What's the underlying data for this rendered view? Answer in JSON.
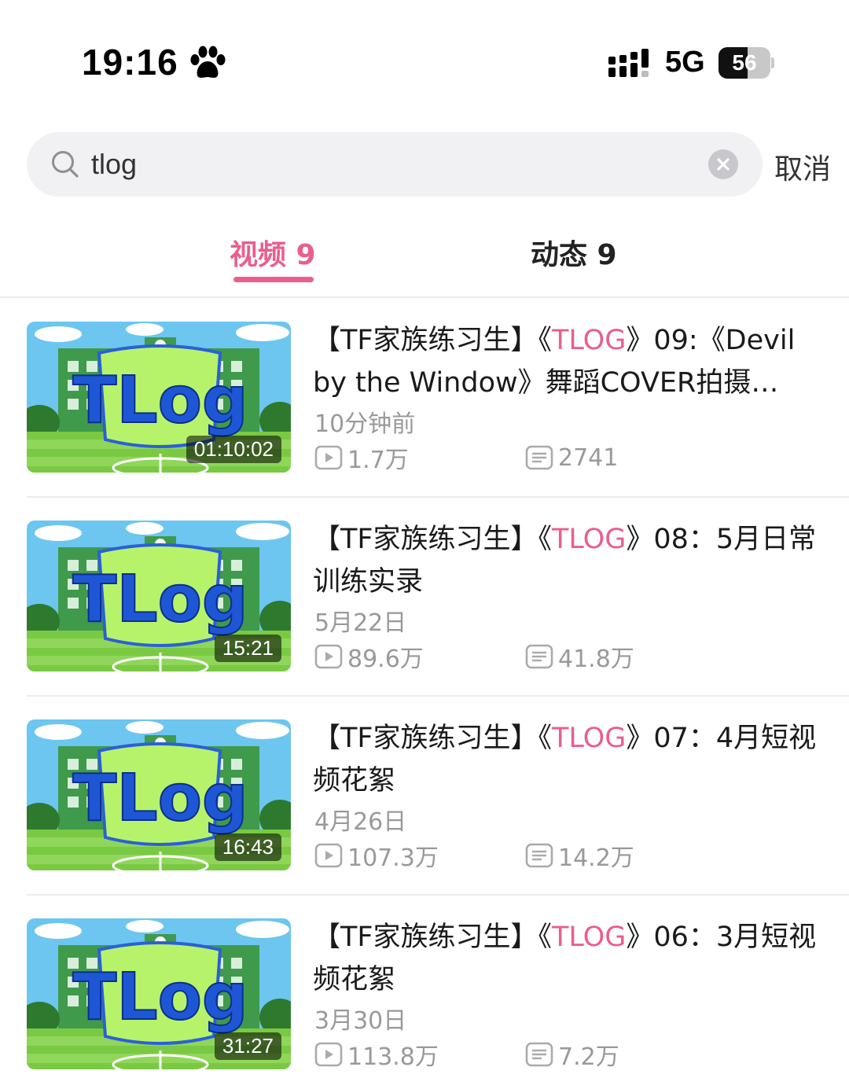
{
  "status_bar": {
    "time": "19:16",
    "time_icon": "paw-icon",
    "network": "5G",
    "battery_level": "56",
    "battery_fraction": 0.56
  },
  "search": {
    "query": "tlog",
    "cancel_label": "取消"
  },
  "tabs": [
    {
      "label": "视频 9",
      "active": true
    },
    {
      "label": "动态 9",
      "active": false
    }
  ],
  "colors": {
    "accent": "#ea5e8f",
    "text_primary": "#1a1a1a",
    "text_secondary": "#999999"
  },
  "videos": [
    {
      "title_prefix": "【TF家族练习生】《",
      "title_highlight": "TLOG",
      "title_suffix": "》09:《Devil by the Window》舞蹈COVER拍摄…",
      "duration": "01:10:02",
      "date": "10分钟前",
      "views": "1.7万",
      "comments": "2741",
      "thumbnail_text": "TLog"
    },
    {
      "title_prefix": "【TF家族练习生】《",
      "title_highlight": "TLOG",
      "title_suffix": "》08：5月日常训练实录",
      "duration": "15:21",
      "date": "5月22日",
      "views": "89.6万",
      "comments": "41.8万",
      "thumbnail_text": "TLog"
    },
    {
      "title_prefix": "【TF家族练习生】《",
      "title_highlight": "TLOG",
      "title_suffix": "》07：4月短视频花絮",
      "duration": "16:43",
      "date": "4月26日",
      "views": "107.3万",
      "comments": "14.2万",
      "thumbnail_text": "TLog"
    },
    {
      "title_prefix": "【TF家族练习生】《",
      "title_highlight": "TLOG",
      "title_suffix": "》06：3月短视频花絮",
      "duration": "31:27",
      "date": "3月30日",
      "views": "113.8万",
      "comments": "7.2万",
      "thumbnail_text": "TLog"
    }
  ]
}
